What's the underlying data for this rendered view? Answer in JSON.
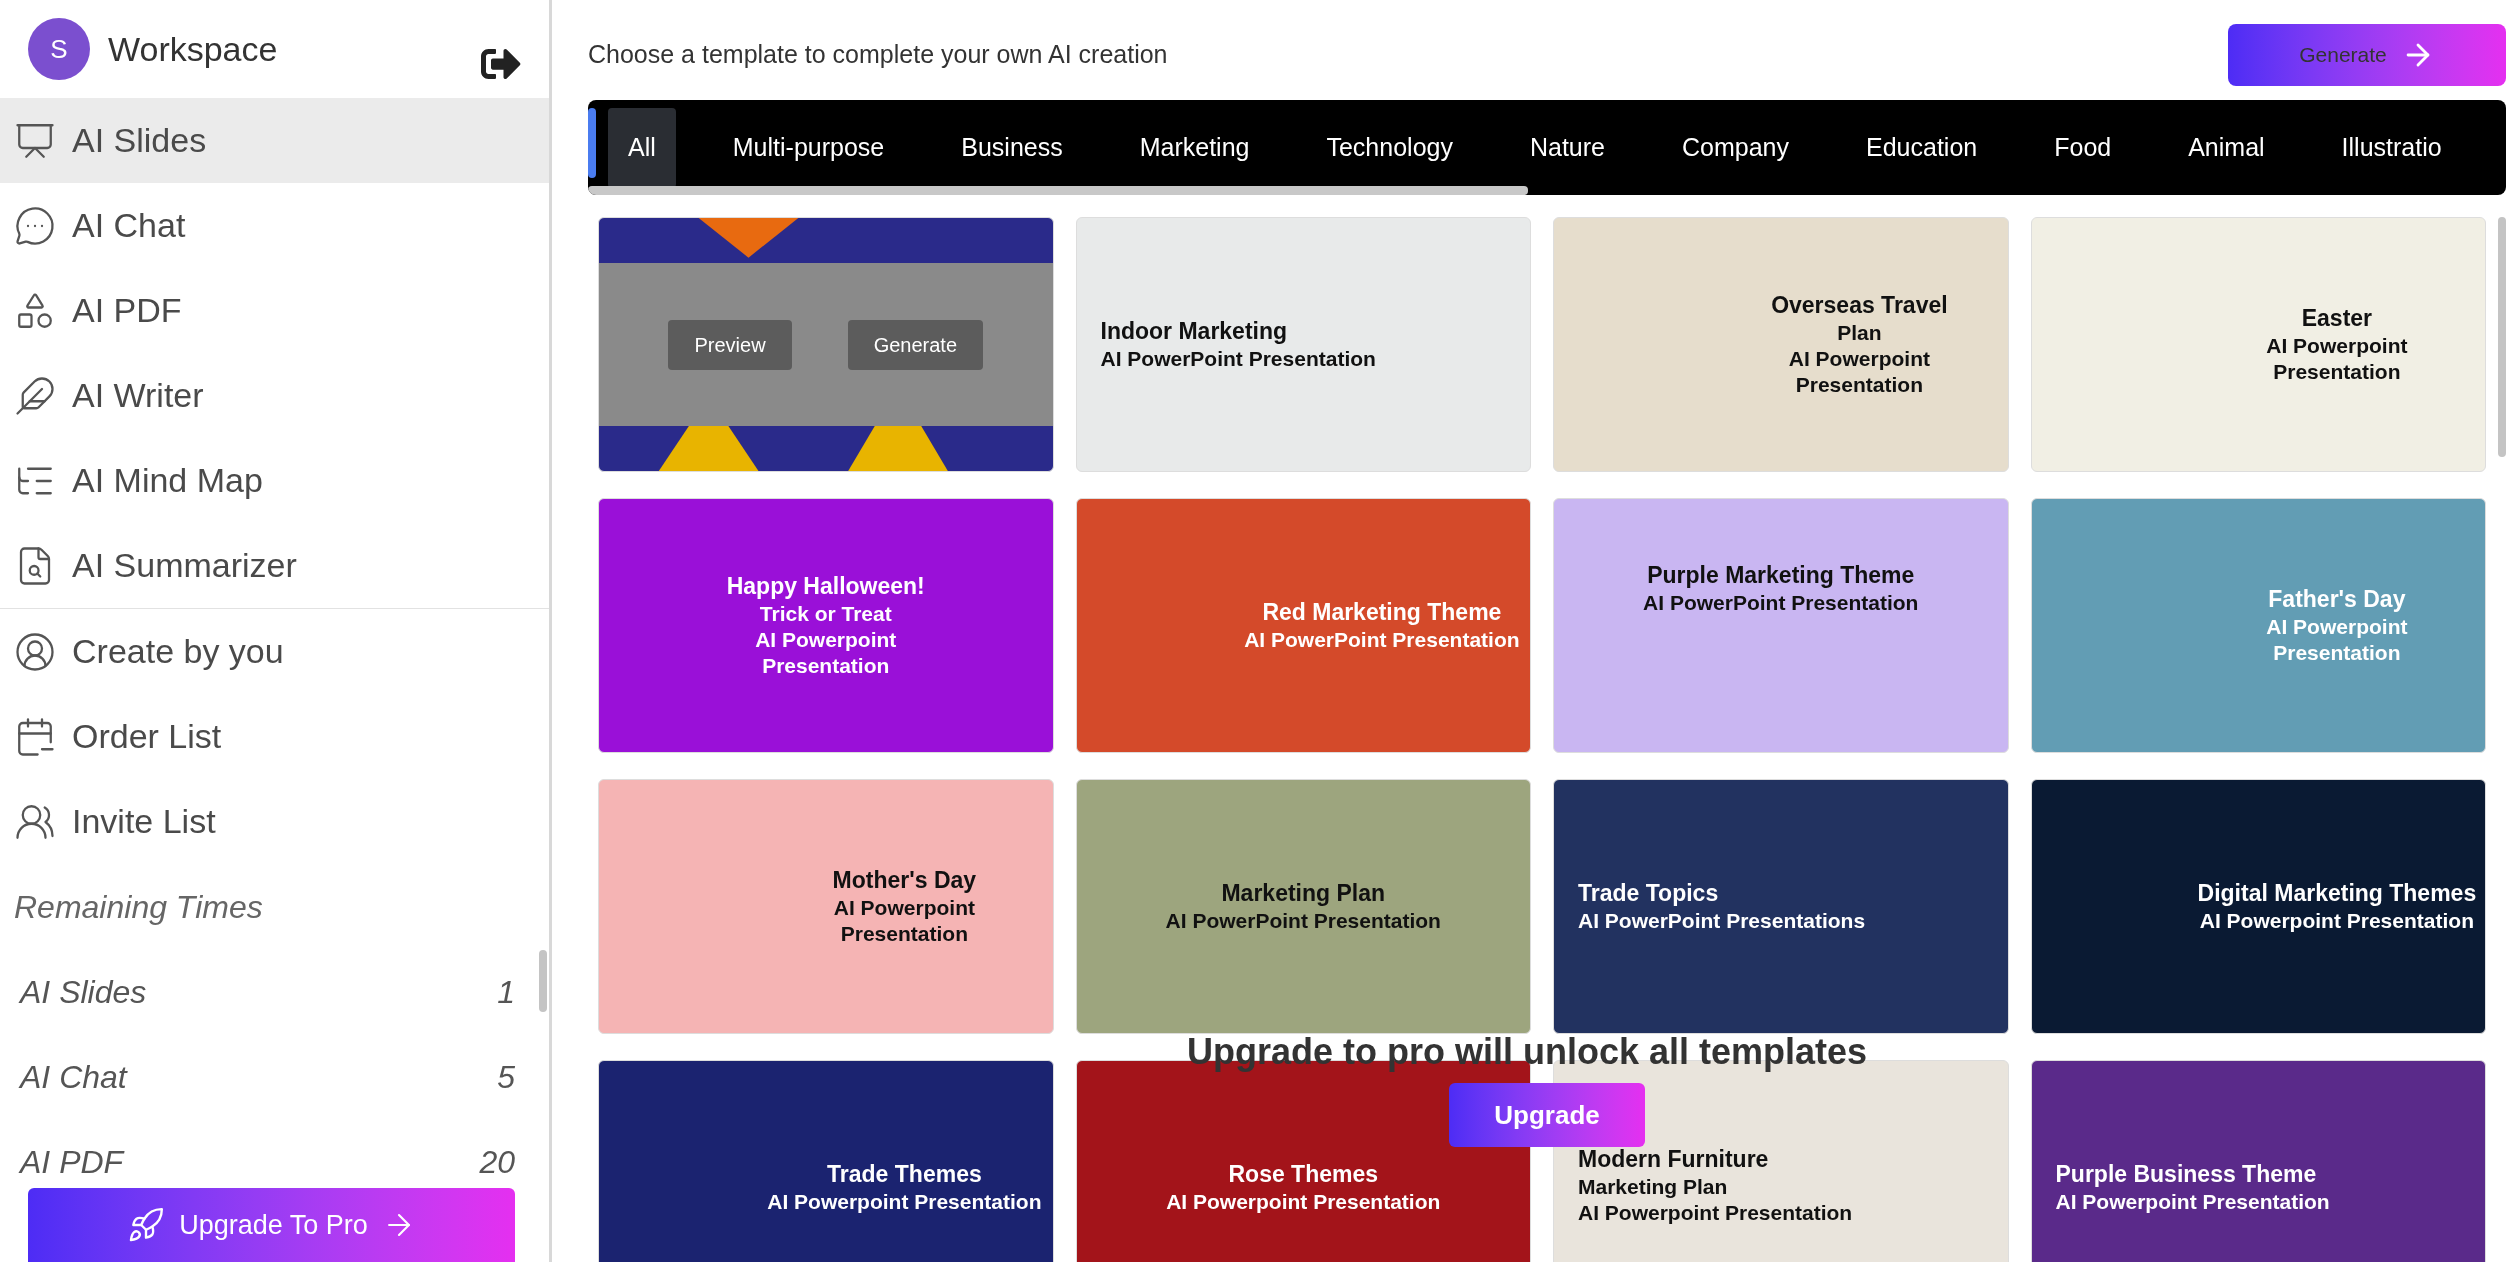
{
  "sidebar": {
    "avatar": "S",
    "workspace": "Workspace",
    "items": [
      {
        "kind": "slides",
        "label": "AI Slides",
        "selected": true
      },
      {
        "kind": "chat",
        "label": "AI Chat",
        "selected": false
      },
      {
        "kind": "pdf",
        "label": "AI PDF",
        "selected": false
      },
      {
        "kind": "writer",
        "label": "AI Writer",
        "selected": false
      },
      {
        "kind": "mindmap",
        "label": "AI Mind Map",
        "selected": false
      },
      {
        "kind": "summarizer",
        "label": "AI Summarizer",
        "selected": false
      }
    ],
    "account_items": [
      {
        "kind": "user",
        "label": "Create by you"
      },
      {
        "kind": "order",
        "label": "Order List"
      },
      {
        "kind": "invite",
        "label": "Invite List"
      }
    ],
    "remaining_title": "Remaining Times",
    "remaining": [
      {
        "label": "AI Slides",
        "count": "1"
      },
      {
        "label": "AI Chat",
        "count": "5"
      },
      {
        "label": "AI PDF",
        "count": "20"
      }
    ],
    "upgrade_button": "Upgrade To Pro"
  },
  "header": {
    "prompt": "Choose a template to complete your own AI creation",
    "generate_button": "Generate"
  },
  "tabs": [
    {
      "label": "All",
      "selected": true
    },
    {
      "label": "Multi-purpose",
      "selected": false
    },
    {
      "label": "Business",
      "selected": false
    },
    {
      "label": "Marketing",
      "selected": false
    },
    {
      "label": "Technology",
      "selected": false
    },
    {
      "label": "Nature",
      "selected": false
    },
    {
      "label": "Company",
      "selected": false
    },
    {
      "label": "Education",
      "selected": false
    },
    {
      "label": "Food",
      "selected": false
    },
    {
      "label": "Animal",
      "selected": false
    },
    {
      "label": "Illustratio",
      "selected": false
    }
  ],
  "templates": [
    {
      "kind": "hover",
      "color": "#2a2a8a",
      "hovered": true,
      "overlay_buttons": [
        "Preview",
        "Generate"
      ]
    },
    {
      "kind": "left",
      "color": "#e8eaea",
      "lines": [
        "Indoor Marketing",
        "AI PowerPoint Presentation"
      ],
      "hovered": false
    },
    {
      "kind": "right",
      "color": "#e6ddcc",
      "lines": [
        "Overseas Travel",
        "Plan",
        "AI Powerpoint",
        "Presentation"
      ],
      "hovered": false
    },
    {
      "kind": "right",
      "color": "#f1efe4",
      "lines": [
        "Easter",
        "AI Powerpoint",
        "Presentation"
      ],
      "hovered": false
    },
    {
      "kind": "center",
      "color": "#9a10d8",
      "lines": [
        "Happy Halloween!",
        "Trick or Treat",
        "AI Powerpoint",
        "Presentation"
      ],
      "hovered": false
    },
    {
      "kind": "right",
      "color": "#d44a2a",
      "lines": [
        "Red Marketing Theme",
        "AI PowerPoint Presentation"
      ],
      "hovered": false
    },
    {
      "kind": "top",
      "color": "#c9b6f2",
      "lines": [
        "Purple Marketing Theme",
        "AI PowerPoint Presentation"
      ],
      "hovered": false
    },
    {
      "kind": "right",
      "color": "#629db4",
      "lines": [
        "Father's Day",
        "AI Powerpoint",
        "Presentation"
      ],
      "hovered": false
    },
    {
      "kind": "right",
      "color": "#f5b4b4",
      "lines": [
        "Mother's Day",
        "AI Powerpoint",
        "Presentation"
      ],
      "hovered": false
    },
    {
      "kind": "center",
      "color": "#9da57e",
      "lines": [
        "Marketing Plan",
        "AI PowerPoint Presentation"
      ],
      "hovered": false
    },
    {
      "kind": "left",
      "color": "#223260",
      "lines": [
        "Trade Topics",
        "AI PowerPoint Presentations"
      ],
      "hovered": false
    },
    {
      "kind": "right",
      "color": "#0a1a33",
      "lines": [
        "Digital Marketing Themes",
        "AI Powerpoint Presentation"
      ],
      "hovered": false
    },
    {
      "kind": "right",
      "color": "#1b2370",
      "lines": [
        "Trade Themes",
        "AI Powerpoint Presentation"
      ],
      "hovered": false
    },
    {
      "kind": "center",
      "color": "#a3141a",
      "lines": [
        "Rose Themes",
        "AI Powerpoint Presentation"
      ],
      "hovered": false
    },
    {
      "kind": "low",
      "color": "#e9e4dc",
      "lines": [
        "Modern Furniture",
        "Marketing Plan",
        "AI Powerpoint Presentation"
      ],
      "hovered": false
    },
    {
      "kind": "left",
      "color": "#5a2a8a",
      "lines": [
        "Purple Business Theme",
        "AI Powerpoint Presentation"
      ],
      "hovered": false
    }
  ],
  "lock_notice": {
    "message": "Upgrade to pro will unlock all templates",
    "button": "Upgrade"
  }
}
